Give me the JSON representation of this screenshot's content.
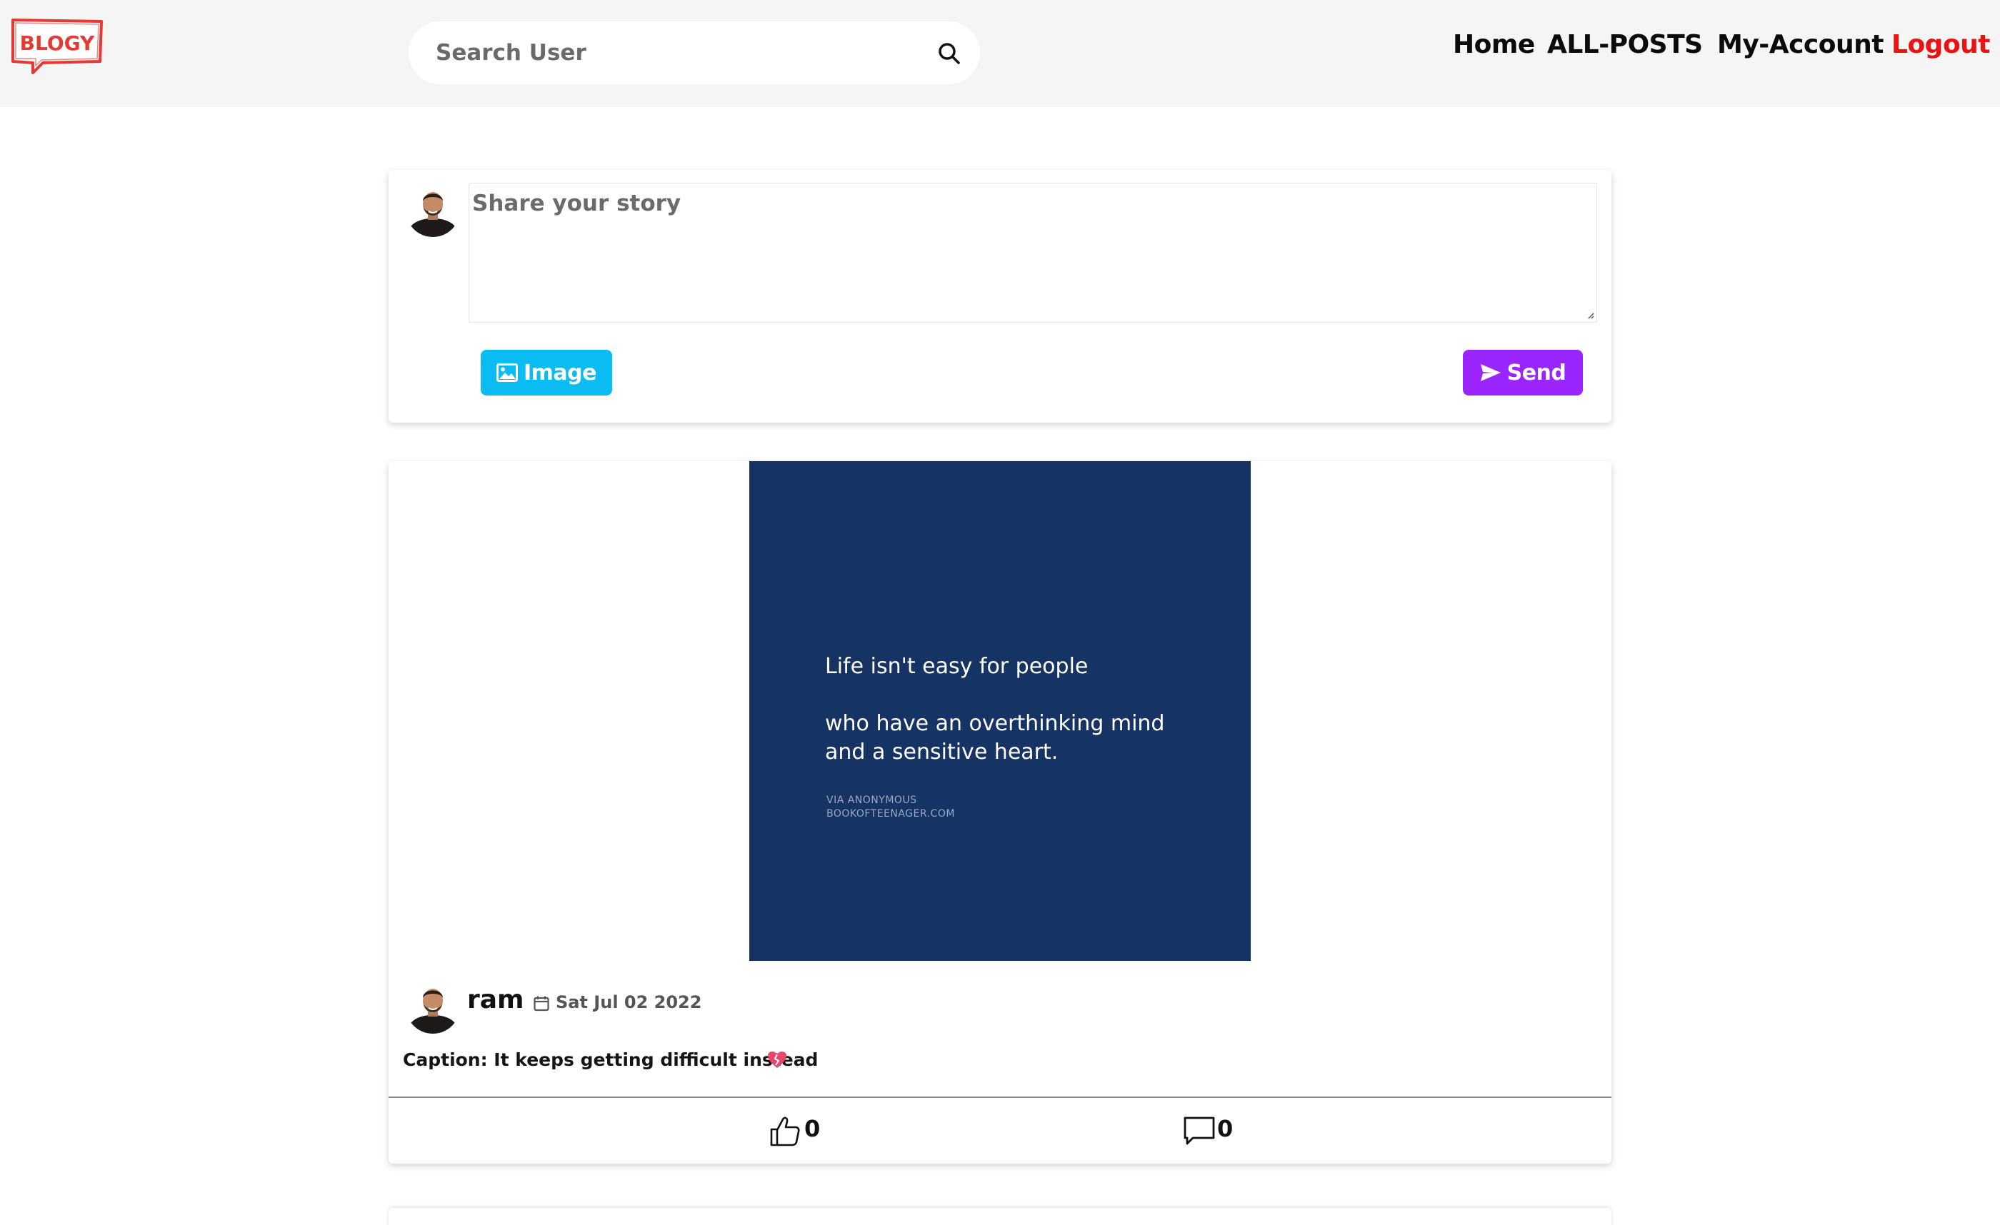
{
  "header": {
    "logo_text": "BLOGY",
    "search": {
      "placeholder": "Search User",
      "value": ""
    },
    "nav": {
      "home": "Home",
      "all_posts": "ALL-POSTS",
      "my_account": "My-Account",
      "logout": "Logout"
    }
  },
  "composer": {
    "placeholder": "Share your story",
    "value": "",
    "image_button": "Image",
    "send_button": "Send"
  },
  "posts": [
    {
      "image_text": {
        "line1": "Life isn't easy for people",
        "line2": "who have an overthinking mind",
        "line3": "and a sensitive heart.",
        "credit1": "VIA ANONYMOUS",
        "credit2": "BOOKOFTEENAGER.COM"
      },
      "user": "ram",
      "date": "Sat Jul 02 2022",
      "caption": "Caption: It keeps getting difficult instead",
      "likes": "0",
      "comments": "0"
    }
  ],
  "colors": {
    "header_bg": "#f5f5f5",
    "logout": "#ee1111",
    "image_button": "#0bbcf2",
    "send_button": "#9b25ff",
    "post_image_bg": "#163463",
    "logo": "#e53935"
  },
  "icons": [
    "logo-icon",
    "search-icon",
    "image-icon",
    "send-icon",
    "calendar-icon",
    "broken-heart-icon",
    "like-icon",
    "comment-icon"
  ]
}
